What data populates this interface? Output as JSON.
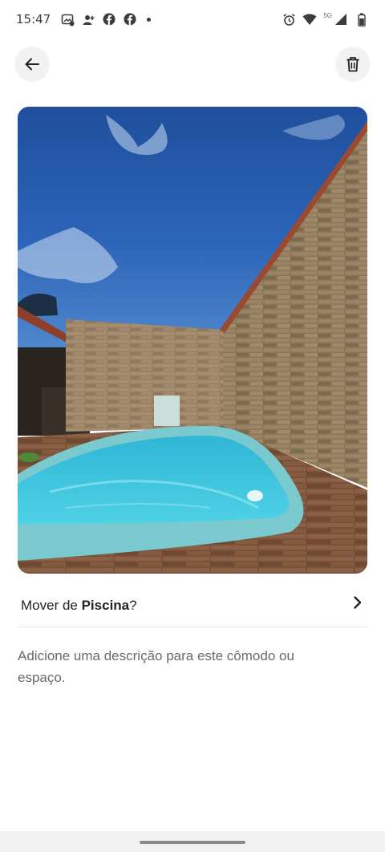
{
  "status_bar": {
    "time": "15:47",
    "network": "5G",
    "left_icons": [
      "gallery-notification-icon",
      "person-add-icon",
      "facebook-icon",
      "facebook-icon",
      "more-dot-icon"
    ],
    "right_icons": [
      "alarm-icon",
      "wifi-icon",
      "signal-icon",
      "battery-icon"
    ]
  },
  "header": {
    "back_icon": "arrow-left-icon",
    "delete_icon": "trash-icon"
  },
  "photo": {
    "subject": "pool-photo"
  },
  "move_row": {
    "prefix": "Mover de ",
    "room": "Piscina",
    "suffix": "?"
  },
  "description": {
    "placeholder": "Adicione uma descrição para este cômodo ou espaço."
  },
  "colors": {
    "background": "#ffffff",
    "button_bg": "#f2f2f2",
    "text": "#222222",
    "muted_text": "#6a6a6a",
    "divider": "#e6e6e6"
  }
}
